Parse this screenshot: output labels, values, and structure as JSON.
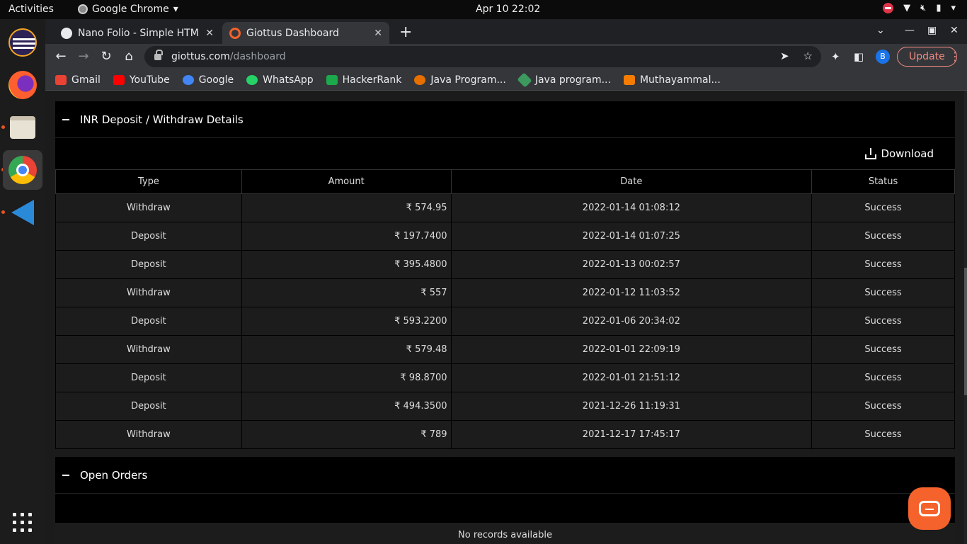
{
  "topbar": {
    "activities": "Activities",
    "app_name": "Google Chrome",
    "clock": "Apr 10  22:02"
  },
  "tabs": [
    {
      "title": "Nano Folio - Simple HTML",
      "close": "✕"
    },
    {
      "title": "Giottus Dashboard",
      "close": "✕"
    }
  ],
  "toolbar": {
    "url_host": "giottus.com",
    "url_path": "/dashboard",
    "profile_initial": "B",
    "update_label": "Update"
  },
  "bookmarks": [
    {
      "label": "Gmail",
      "color": "#ea4335"
    },
    {
      "label": "YouTube",
      "color": "#ff0000"
    },
    {
      "label": "Google",
      "color": "#4285f4"
    },
    {
      "label": "WhatsApp",
      "color": "#25d366"
    },
    {
      "label": "HackerRank",
      "color": "#1ba94c"
    },
    {
      "label": "Java Program...",
      "color": "#e76f00"
    },
    {
      "label": "Java program...",
      "color": "#3c9a5f"
    },
    {
      "label": "Muthayammal...",
      "color": "#f57c00"
    }
  ],
  "deposit_panel": {
    "title": "INR Deposit / Withdraw Details",
    "download_label": "Download",
    "columns": [
      "Type",
      "Amount",
      "Date",
      "Status"
    ],
    "rows": [
      {
        "type": "Withdraw",
        "amount": "₹ 574.95",
        "date": "2022-01-14 01:08:12",
        "status": "Success"
      },
      {
        "type": "Deposit",
        "amount": "₹ 197.7400",
        "date": "2022-01-14 01:07:25",
        "status": "Success"
      },
      {
        "type": "Deposit",
        "amount": "₹ 395.4800",
        "date": "2022-01-13 00:02:57",
        "status": "Success"
      },
      {
        "type": "Withdraw",
        "amount": "₹ 557",
        "date": "2022-01-12 11:03:52",
        "status": "Success"
      },
      {
        "type": "Deposit",
        "amount": "₹ 593.2200",
        "date": "2022-01-06 20:34:02",
        "status": "Success"
      },
      {
        "type": "Withdraw",
        "amount": "₹ 579.48",
        "date": "2022-01-01 22:09:19",
        "status": "Success"
      },
      {
        "type": "Deposit",
        "amount": "₹ 98.8700",
        "date": "2022-01-01 21:51:12",
        "status": "Success"
      },
      {
        "type": "Deposit",
        "amount": "₹ 494.3500",
        "date": "2021-12-26 11:19:31",
        "status": "Success"
      },
      {
        "type": "Withdraw",
        "amount": "₹ 789",
        "date": "2021-12-17 17:45:17",
        "status": "Success"
      }
    ]
  },
  "orders_panel": {
    "title": "Open Orders",
    "empty_text": "No records available"
  },
  "colors": {
    "accent": "#f5622b",
    "update": "#f28b82"
  }
}
